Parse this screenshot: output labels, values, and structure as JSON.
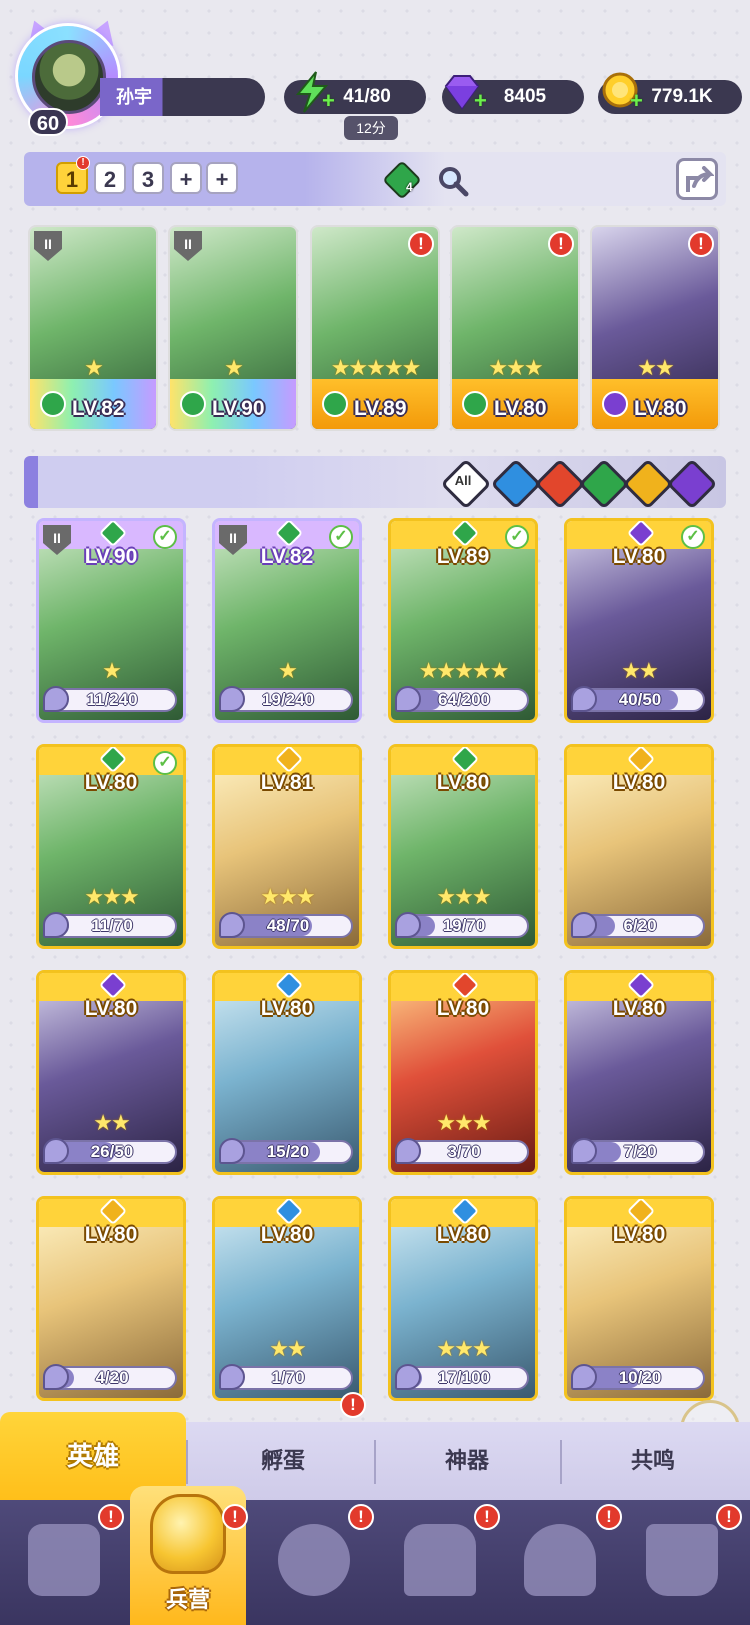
{
  "player": {
    "level": "60",
    "name": "孙宇"
  },
  "resources": {
    "energy": {
      "value": "41/80",
      "timer": "12分",
      "icon": "lightning-icon"
    },
    "gems": {
      "value": "8405",
      "icon": "gem-icon"
    },
    "gold": {
      "value": "779.1K",
      "icon": "coin-icon"
    }
  },
  "team_tabs": [
    "1",
    "2",
    "3",
    "+",
    "+"
  ],
  "team_element_count": "4",
  "team": [
    {
      "level": "LV.82",
      "element": "wind",
      "stars": 1,
      "frame": "rainbow"
    },
    {
      "level": "LV.90",
      "element": "wind",
      "stars": 1,
      "frame": "rainbow"
    },
    {
      "level": "LV.89",
      "element": "wind",
      "stars": 5,
      "frame": "gold"
    },
    {
      "level": "LV.80",
      "element": "wind",
      "stars": 3,
      "frame": "gold"
    },
    {
      "level": "LV.80",
      "element": "dark",
      "stars": 2,
      "frame": "gold"
    }
  ],
  "filters": [
    "All",
    "water",
    "fire",
    "wind",
    "light",
    "dark"
  ],
  "heroes": [
    {
      "level": "LV.90",
      "element": "wind",
      "frag": "11/240",
      "progress": 0.05,
      "stars": 1,
      "rarity": "purple",
      "checked": true,
      "locked": true
    },
    {
      "level": "LV.82",
      "element": "wind",
      "frag": "19/240",
      "progress": 0.08,
      "stars": 1,
      "rarity": "purple",
      "checked": true,
      "locked": true
    },
    {
      "level": "LV.89",
      "element": "wind",
      "frag": "64/200",
      "progress": 0.32,
      "stars": 5,
      "rarity": "gold",
      "checked": true
    },
    {
      "level": "LV.80",
      "element": "dark",
      "frag": "40/50",
      "progress": 0.8,
      "stars": 2,
      "rarity": "gold",
      "checked": true
    },
    {
      "level": "LV.80",
      "element": "wind",
      "frag": "11/70",
      "progress": 0.16,
      "stars": 3,
      "rarity": "gold",
      "checked": true
    },
    {
      "level": "LV.81",
      "element": "light",
      "frag": "48/70",
      "progress": 0.69,
      "stars": 3,
      "rarity": "gold"
    },
    {
      "level": "LV.80",
      "element": "wind",
      "frag": "19/70",
      "progress": 0.27,
      "stars": 3,
      "rarity": "gold"
    },
    {
      "level": "LV.80",
      "element": "light",
      "frag": "6/20",
      "progress": 0.3,
      "stars": 0,
      "rarity": "gold"
    },
    {
      "level": "LV.80",
      "element": "dark",
      "frag": "26/50",
      "progress": 0.52,
      "stars": 2,
      "rarity": "gold"
    },
    {
      "level": "LV.80",
      "element": "water",
      "frag": "15/20",
      "progress": 0.75,
      "stars": 0,
      "rarity": "gold"
    },
    {
      "level": "LV.80",
      "element": "fire",
      "frag": "3/70",
      "progress": 0.04,
      "stars": 3,
      "rarity": "gold"
    },
    {
      "level": "LV.80",
      "element": "dark",
      "frag": "7/20",
      "progress": 0.35,
      "stars": 0,
      "rarity": "gold"
    },
    {
      "level": "LV.80",
      "element": "light",
      "frag": "4/20",
      "progress": 0.2,
      "stars": 0,
      "rarity": "gold"
    },
    {
      "level": "LV.80",
      "element": "water",
      "frag": "1/70",
      "progress": 0.01,
      "stars": 2,
      "rarity": "gold"
    },
    {
      "level": "LV.80",
      "element": "water",
      "frag": "17/100",
      "progress": 0.17,
      "stars": 3,
      "rarity": "gold"
    },
    {
      "level": "LV.80",
      "element": "light",
      "frag": "10/20",
      "progress": 0.5,
      "stars": 0,
      "rarity": "gold"
    }
  ],
  "sub_tabs": [
    "英雄",
    "孵蛋",
    "神器",
    "共鸣"
  ],
  "nav": {
    "active_label": "兵营"
  },
  "colors": {
    "wind": "#2fa64a",
    "dark": "#7a3fd0",
    "water": "#2f8fe0",
    "fire": "#e2462c",
    "light": "#f0b21c"
  }
}
